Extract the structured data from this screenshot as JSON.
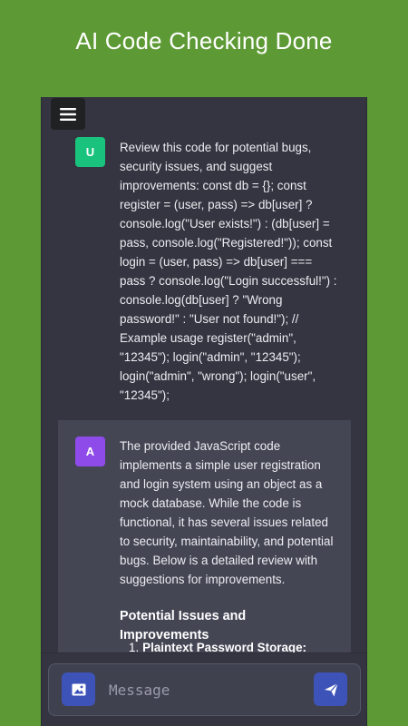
{
  "banner": {
    "title": "AI Code Checking Done"
  },
  "chat": {
    "user_message": {
      "avatar": "U",
      "text": "Review this code for potential bugs, security issues, and suggest improvements: const db = {}; const register = (user, pass) => db[user] ? console.log(\"User exists!\") : (db[user] = pass, console.log(\"Registered!\")); const login = (user, pass) => db[user] === pass ? console.log(\"Login successful!\") : console.log(db[user] ? \"Wrong password!\" : \"User not found!\"); // Example usage register(\"admin\", \"12345\"); login(\"admin\", \"12345\"); login(\"admin\", \"wrong\"); login(\"user\", \"12345\");"
    },
    "ai_message": {
      "avatar": "A",
      "text": "The provided JavaScript code implements a simple user registration and login system using an object as a mock database. While the code is functional, it has several issues related to security, maintainability, and potential bugs. Below is a detailed review with suggestions for improvements.",
      "heading": "Potential Issues and Improvements",
      "list_number": "1.",
      "list_item": "Plaintext Password Storage:"
    }
  },
  "composer": {
    "placeholder": "Message",
    "attach_icon": "image-icon",
    "send_icon": "send-icon"
  },
  "toolbar": {
    "menu_icon": "hamburger-menu-icon"
  },
  "colors": {
    "banner_bg": "#5d9a35",
    "chat_bg": "#343541",
    "ai_bubble_bg": "#444654",
    "user_avatar": "#19c37d",
    "ai_avatar": "#8f4bea",
    "button_bg": "#3d53b8"
  }
}
